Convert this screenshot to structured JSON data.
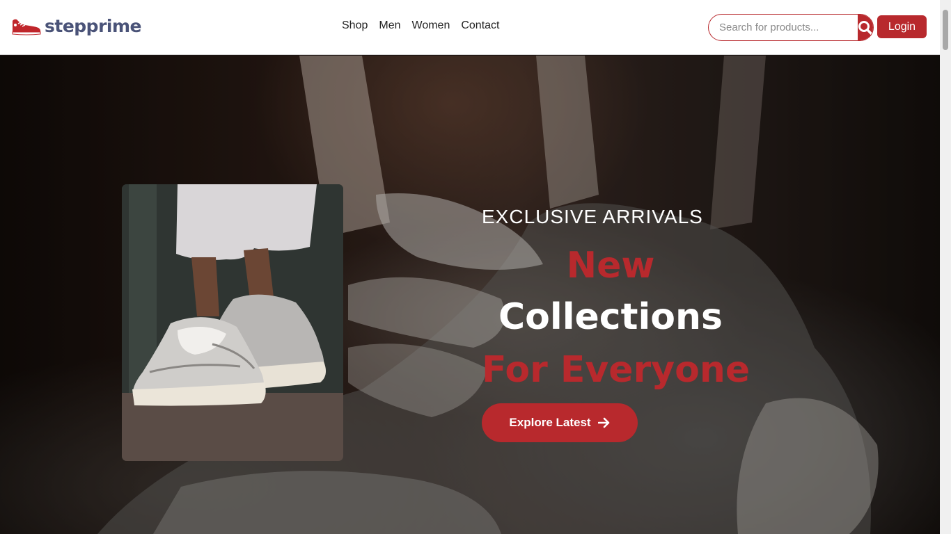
{
  "brand": {
    "name": "stepprime"
  },
  "nav": {
    "items": [
      "Shop",
      "Men",
      "Women",
      "Contact"
    ]
  },
  "search": {
    "placeholder": "Search for products..."
  },
  "login": {
    "label": "Login"
  },
  "hero": {
    "eyebrow": "EXCLUSIVE ARRIVALS",
    "line1": "New",
    "line2": "Collections",
    "line3": "For Everyone",
    "cta": "Explore Latest"
  },
  "colors": {
    "accent": "#b8292d",
    "brand_text": "#4a5378"
  },
  "icons": {
    "logo": "sneaker-icon",
    "search": "search-icon",
    "cta": "arrow-right-icon"
  }
}
